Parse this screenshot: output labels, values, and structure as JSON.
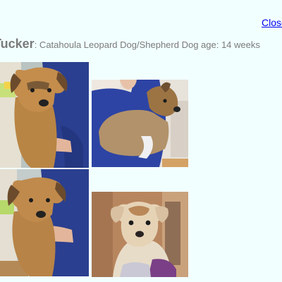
{
  "close_link": "Close",
  "pet": {
    "name": "Tucker",
    "description": ": Catahoula Leopard Dog/Shepherd Dog age: 14 weeks"
  },
  "colors": {
    "background": "#f2ffff",
    "link": "#0000ee",
    "heading_text": "#7a7a7a"
  },
  "photos": [
    {
      "subject": "puppy held by person in blue scrubs",
      "icon": "puppy-photo"
    },
    {
      "subject": "puppy held in arms, side view",
      "icon": "puppy-photo"
    },
    {
      "subject": "puppy held by person in blue scrubs",
      "icon": "puppy-photo"
    },
    {
      "subject": "puppy sitting on lap",
      "icon": "puppy-photo"
    }
  ]
}
